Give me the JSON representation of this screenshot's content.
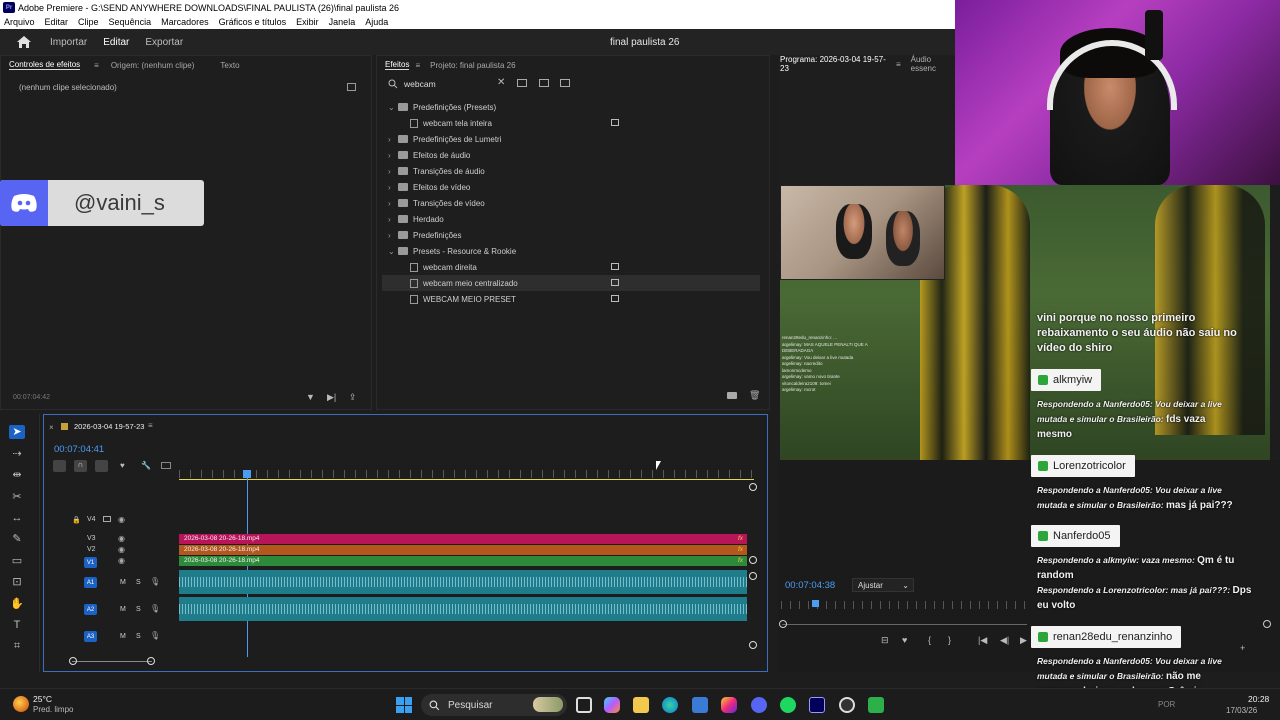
{
  "window": {
    "title": "Adobe Premiere - G:\\SEND ANYWHERE DOWNLOADS\\FINAL PAULISTA (26)\\final paulista 26",
    "logo": "Pr"
  },
  "menu": [
    "Arquivo",
    "Editar",
    "Clipe",
    "Sequência",
    "Marcadores",
    "Gráficos e títulos",
    "Exibir",
    "Janela",
    "Ajuda"
  ],
  "workspace": {
    "tabs": [
      "Importar",
      "Editar",
      "Exportar"
    ],
    "active": "Editar",
    "project_title": "final paulista 26"
  },
  "effect_controls": {
    "tabs": [
      "Controles de efeitos",
      "Origem: (nenhum clipe)",
      "Texto"
    ],
    "empty_message": "(nenhum clipe selecionado)",
    "timecode": "00:07:04:42"
  },
  "discord_overlay": {
    "handle": "@vaini_s"
  },
  "effects_panel": {
    "tabs": [
      "Efeitos",
      "Projeto: final paulista 26"
    ],
    "search_value": "webcam",
    "tree": [
      {
        "label": "Predefinições (Presets)",
        "type": "folder",
        "expanded": true,
        "level": 0
      },
      {
        "label": "webcam tela inteira",
        "type": "preset",
        "level": 1
      },
      {
        "label": "Predefinições de Lumetri",
        "type": "folder",
        "expanded": false,
        "level": 0
      },
      {
        "label": "Efeitos de áudio",
        "type": "folder",
        "expanded": false,
        "level": 0
      },
      {
        "label": "Transições de áudio",
        "type": "folder",
        "expanded": false,
        "level": 0
      },
      {
        "label": "Efeitos de vídeo",
        "type": "folder",
        "expanded": false,
        "level": 0
      },
      {
        "label": "Transições de vídeo",
        "type": "folder",
        "expanded": false,
        "level": 0
      },
      {
        "label": "Herdado",
        "type": "folder",
        "expanded": false,
        "level": 0
      },
      {
        "label": "Predefinições",
        "type": "folder",
        "expanded": false,
        "level": 0
      },
      {
        "label": "Presets - Resource & Rookie",
        "type": "folder",
        "expanded": true,
        "level": 0
      },
      {
        "label": "webcam direita",
        "type": "preset",
        "level": 1
      },
      {
        "label": "webcam meio centralizado",
        "type": "preset",
        "level": 1,
        "selected": true
      },
      {
        "label": "WEBCAM MEIO PRESET",
        "type": "preset",
        "level": 1
      }
    ]
  },
  "program_monitor": {
    "tabs": [
      "Programa: 2026-03-04 19-57-23",
      "Áudio essenc"
    ],
    "timecode": "00:07:04:38",
    "fit": "Ajustar"
  },
  "stream_chat": {
    "top_text": "vini porque no nosso primeiro rebaixamento o seu áudio não saiu no vídeo do shiro",
    "messages": [
      {
        "user": "alkmyiw",
        "reply": "Respondendo a Nanferdo05: Vou deixar a live mutada e simular o Brasileirão:",
        "msg": "fds vaza mesmo"
      },
      {
        "user": "Lorenzotricolor",
        "reply": "Respondendo a Nanferdo05: Vou deixar a live mutada e simular o Brasileirão:",
        "msg": "mas já pai???"
      },
      {
        "user": "Nanferdo05",
        "reply": "Respondendo a alkmyiw: vaza mesmo:",
        "msg": "Qm é tu random",
        "reply2": "Respondendo a Lorenzotricolor: mas já pai???:",
        "msg2": "Dps eu volto"
      },
      {
        "user": "renan28edu_renanzinho",
        "reply": "Respondendo a Nanferdo05: Vou deixar a live mutada e simular o Brasileirão:",
        "msg": "não me surpreenderia vc colocar o Grêmio campeão"
      }
    ],
    "mini_chat": [
      "renan28edu_renanzinho: ...",
      "argelimay: MAS AQUELE PENALTI QUE A DEBERADAGA",
      "argelimay: Vou deixar a live mutada",
      "argelimay: nacredito",
      "lamonmcdemo",
      "argelimay: vamo novo tirante",
      "vitoncaldeira2109: tomei",
      "argelimay: rocrot"
    ]
  },
  "timeline": {
    "sequence_name": "2026-03-04 19-57-23",
    "timecode": "00:07:04:41",
    "tracks": {
      "video": [
        {
          "name": "V4",
          "clip": null
        },
        {
          "name": "V3",
          "clip": "2026-03-08 20-26-18.mp4",
          "color": "#b8145a"
        },
        {
          "name": "V2",
          "clip": "2026-03-08 20-26-18.mp4",
          "color": "#b3571c"
        },
        {
          "name": "V1",
          "clip": "2026-03-08 20-26-18.mp4",
          "color": "#2d8a3a"
        }
      ],
      "audio": [
        {
          "name": "A1",
          "m": "M",
          "s": "S"
        },
        {
          "name": "A2",
          "m": "M",
          "s": "S"
        },
        {
          "name": "A3",
          "m": "M",
          "s": "S"
        }
      ],
      "fx_label": "fx"
    }
  },
  "taskbar": {
    "weather_temp": "25°C",
    "weather_desc": "Pred. limpo",
    "search_placeholder": "Pesquisar",
    "lang": "POR",
    "time": "20:28",
    "date": "17/03/26"
  }
}
